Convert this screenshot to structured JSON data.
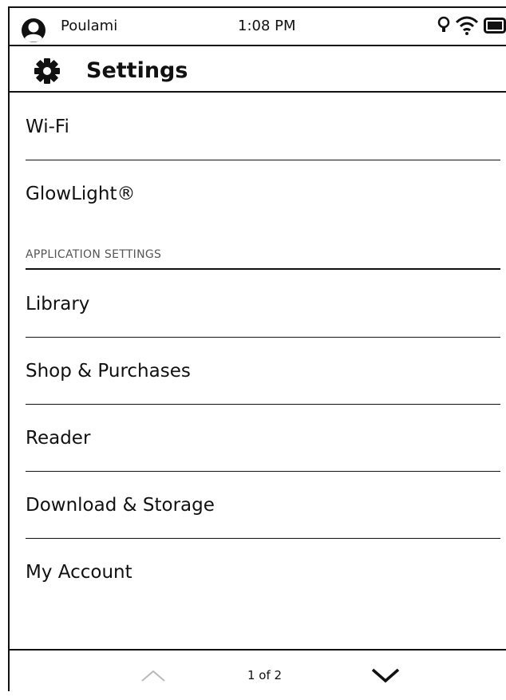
{
  "status": {
    "user": "Poulami",
    "time": "1:08 PM",
    "icons": [
      "avatar-icon",
      "lightbulb-icon",
      "wifi-icon",
      "battery-icon"
    ]
  },
  "header": {
    "title": "Settings",
    "icon": "gear-icon"
  },
  "items": [
    {
      "label": "Wi-Fi"
    },
    {
      "label": "GlowLight®"
    }
  ],
  "application_section": {
    "label": "APPLICATION SETTINGS",
    "items": [
      {
        "label": "Library"
      },
      {
        "label": "Shop & Purchases"
      },
      {
        "label": "Reader"
      },
      {
        "label": "Download & Storage"
      },
      {
        "label": "My Account"
      }
    ]
  },
  "pagination": {
    "label": "1 of 2",
    "prev_icon": "chevron-up-icon",
    "next_icon": "chevron-down-icon"
  }
}
